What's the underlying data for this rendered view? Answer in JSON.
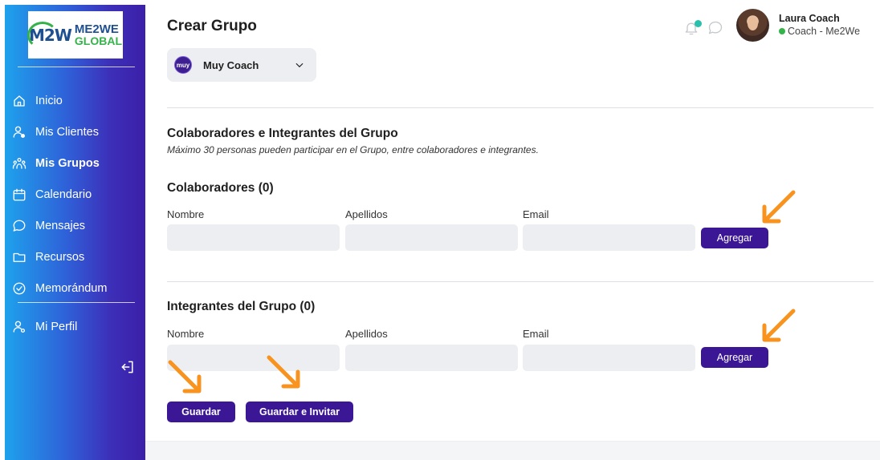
{
  "app": {
    "logo_line1": "ME2WE",
    "logo_line2": "GLOBAL",
    "logo_mark": "M2W"
  },
  "sidebar": {
    "items": [
      {
        "label": "Inicio",
        "icon": "home-icon"
      },
      {
        "label": "Mis Clientes",
        "icon": "clients-icon"
      },
      {
        "label": "Mis Grupos",
        "icon": "groups-icon",
        "active": true
      },
      {
        "label": "Calendario",
        "icon": "calendar-icon"
      },
      {
        "label": "Mensajes",
        "icon": "message-icon"
      },
      {
        "label": "Recursos",
        "icon": "folder-icon"
      },
      {
        "label": "Memorándum",
        "icon": "check-circle-icon"
      }
    ],
    "profile": {
      "label": "Mi Perfil",
      "icon": "profile-icon"
    },
    "logout_icon": "logout-icon"
  },
  "header": {
    "title": "Crear Grupo",
    "org": {
      "badge": "muy",
      "name": "Muy Coach"
    },
    "user": {
      "name": "Laura Coach",
      "role": "Coach - Me2We",
      "status_color": "#35b34a"
    }
  },
  "group": {
    "title": "Colaboradores e Integrantes del Grupo",
    "subtitle": "Máximo 30 personas pueden participar en el Grupo, entre colaboradores e integrantes."
  },
  "collaborators": {
    "title": "Colaboradores (0)",
    "labels": {
      "first": "Nombre",
      "last": "Apellidos",
      "email": "Email"
    },
    "values": {
      "first": "",
      "last": "",
      "email": ""
    },
    "add_label": "Agregar"
  },
  "members": {
    "title": "Integrantes del Grupo (0)",
    "labels": {
      "first": "Nombre",
      "last": "Apellidos",
      "email": "Email"
    },
    "values": {
      "first": "",
      "last": "",
      "email": ""
    },
    "add_label": "Agregar"
  },
  "actions": {
    "save": "Guardar",
    "save_invite": "Guardar e Invitar"
  },
  "colors": {
    "primary_button": "#3b1796",
    "sidebar_gradient_start": "#1ea2ec",
    "sidebar_gradient_end": "#3b1fa8",
    "arrow": "#f7931e"
  }
}
